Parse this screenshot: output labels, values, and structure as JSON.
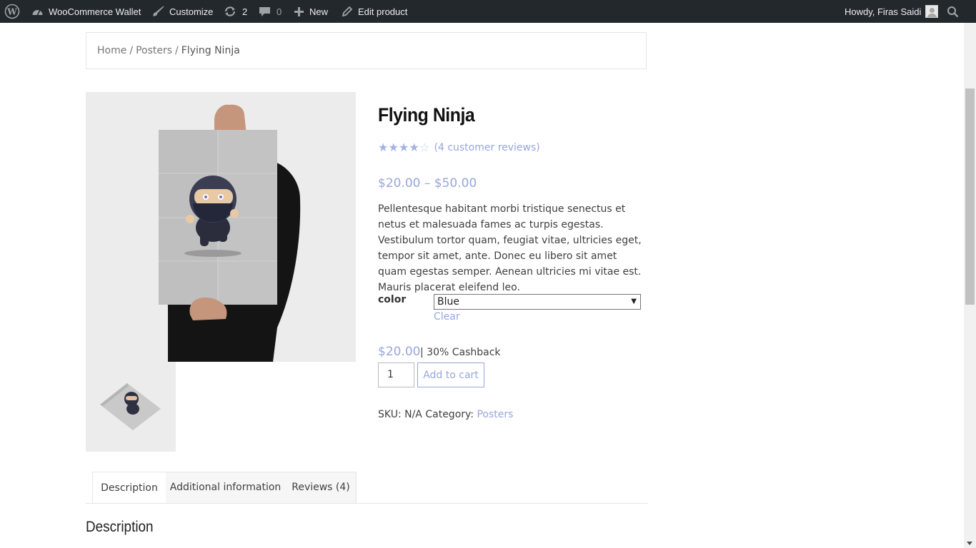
{
  "admin_bar": {
    "site_name": "WooCommerce Wallet",
    "customize": "Customize",
    "updates_count": "2",
    "comments_count": "0",
    "new_label": "New",
    "edit_product": "Edit product",
    "greeting": "Howdy, Firas Saidi",
    "icons": [
      "wordpress-logo-icon",
      "dashboard-icon",
      "brush-icon",
      "updates-icon",
      "comments-icon",
      "plus-icon",
      "pencil-icon",
      "avatar",
      "search-icon"
    ]
  },
  "breadcrumb": {
    "home": "Home",
    "separator": "/",
    "category": "Posters",
    "current": "Flying Ninja"
  },
  "product": {
    "title": "Flying Ninja",
    "rating": 4,
    "rating_max": 5,
    "reviews_link": "(4 customer reviews)",
    "price_range": "$20.00 – $50.00",
    "description": "Pellentesque habitant morbi tristique senectus et netus et malesuada fames ac turpis egestas. Vestibulum tortor quam, feugiat vitae, ultricies eget, tempor sit amet, ante. Donec eu libero sit amet quam egestas semper. Aenean ultricies mi vitae est. Mauris placerat eleifend leo.",
    "variation_label": "color",
    "variation_selected": "Blue",
    "clear_label": "Clear",
    "variation_price": "$20.00",
    "cashback": "| 30% Cashback",
    "quantity": "1",
    "add_to_cart": "Add to cart",
    "sku_label": "SKU:",
    "sku_value": "N/A",
    "category_label": "Category:",
    "category_value": "Posters"
  },
  "tabs": [
    {
      "label": "Description",
      "active": true
    },
    {
      "label": "Additional information",
      "active": false
    },
    {
      "label": "Reviews (4)",
      "active": false
    }
  ],
  "section_heading": "Description",
  "colors": {
    "admin_bar_bg": "#23282d",
    "accent": "#97a6dc",
    "text": "#404040",
    "image_bg": "#ececec"
  }
}
